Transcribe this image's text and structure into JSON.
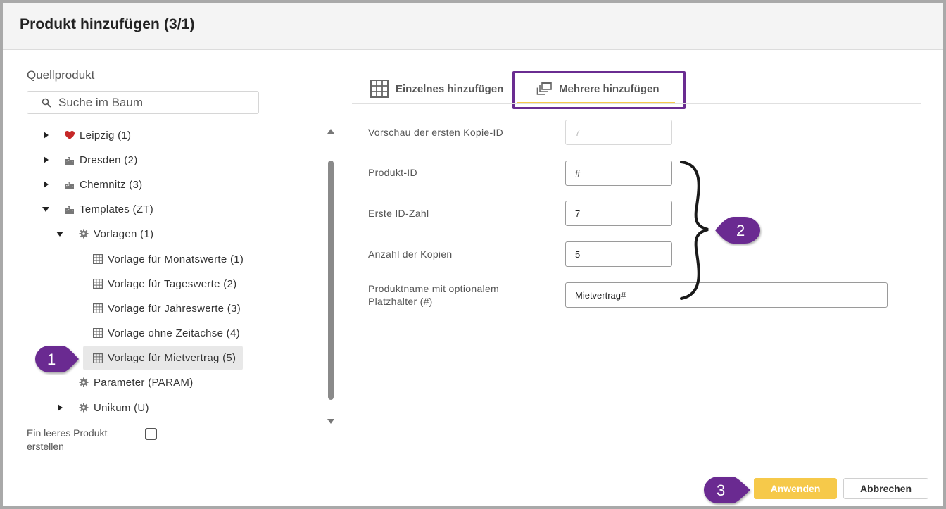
{
  "dialog": {
    "title": "Produkt hinzufügen (3/1)"
  },
  "source": {
    "label": "Quellprodukt",
    "search_placeholder": "Suche im Baum"
  },
  "tree": {
    "items": [
      {
        "label": "Leipzig (1)",
        "icon": "heart-icon",
        "expander": "collapsed"
      },
      {
        "label": "Dresden (2)",
        "icon": "building-icon",
        "expander": "collapsed"
      },
      {
        "label": "Chemnitz (3)",
        "icon": "building-icon",
        "expander": "collapsed"
      },
      {
        "label": "Templates (ZT)",
        "icon": "building-icon",
        "expander": "expanded"
      },
      {
        "label": "Vorlagen (1)",
        "icon": "gear-icon",
        "expander": "expanded"
      },
      {
        "label": "Vorlage für Monatswerte (1)",
        "icon": "grid-icon",
        "expander": "none"
      },
      {
        "label": "Vorlage für Tageswerte (2)",
        "icon": "grid-icon",
        "expander": "none"
      },
      {
        "label": "Vorlage für Jahreswerte (3)",
        "icon": "grid-icon",
        "expander": "none"
      },
      {
        "label": "Vorlage ohne Zeitachse (4)",
        "icon": "grid-icon",
        "expander": "none"
      },
      {
        "label": "Vorlage für Mietvertrag (5)",
        "icon": "grid-icon",
        "expander": "none",
        "selected": true
      },
      {
        "label": "Parameter (PARAM)",
        "icon": "gear-icon",
        "expander": "none"
      },
      {
        "label": "Unikum (U)",
        "icon": "gear-icon",
        "expander": "collapsed"
      }
    ]
  },
  "empty_product": {
    "label": "Ein leeres Produkt erstellen",
    "checked": false
  },
  "tabs": [
    {
      "label": "Einzelnes hinzufügen",
      "icon": "table-icon",
      "active": false
    },
    {
      "label": "Mehrere hinzufügen",
      "icon": "copies-icon",
      "active": true
    }
  ],
  "form": {
    "preview": {
      "label": "Vorschau der ersten Kopie-ID",
      "value": "7"
    },
    "product_id": {
      "label": "Produkt-ID",
      "value": "#"
    },
    "first_id": {
      "label": "Erste ID-Zahl",
      "value": "7"
    },
    "copies": {
      "label": "Anzahl der Kopien",
      "value": "5"
    },
    "name": {
      "label": "Produktname mit optionalem Platzhalter (#)",
      "value": "Mietvertrag#"
    }
  },
  "callouts": {
    "one": "1",
    "two": "2",
    "three": "3"
  },
  "buttons": {
    "apply": "Anwenden",
    "cancel": "Abbrechen"
  },
  "colors": {
    "accent": "#f6c94a",
    "highlight": "#6a2c91",
    "heart": "#c62828"
  }
}
